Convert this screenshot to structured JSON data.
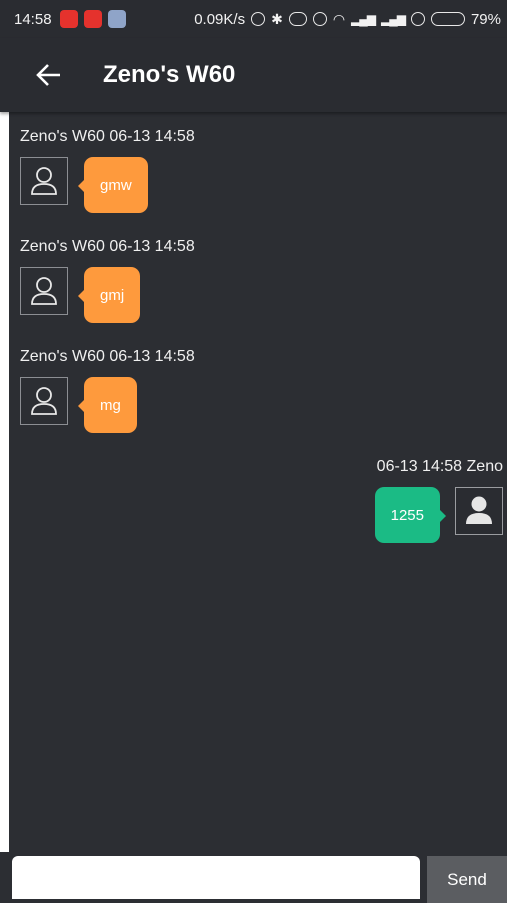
{
  "status_bar": {
    "time": "14:58",
    "net_speed": "0.09K/s",
    "battery_percent": "79%",
    "battery_level": 0.79
  },
  "header": {
    "title": "Zeno's W60"
  },
  "messages": [
    {
      "direction": "incoming",
      "meta": "Zeno's W60  06-13 14:58",
      "text": "gmw"
    },
    {
      "direction": "incoming",
      "meta": "Zeno's W60  06-13 14:58",
      "text": "gmj"
    },
    {
      "direction": "incoming",
      "meta": "Zeno's W60  06-13 14:58",
      "text": "mg"
    },
    {
      "direction": "outgoing",
      "meta": "06-13 14:58  Zeno",
      "text": "1255"
    }
  ],
  "composer": {
    "input_value": "",
    "send_label": "Send"
  },
  "colors": {
    "incoming_bubble": "#fe9a3d",
    "outgoing_bubble": "#1bbb85",
    "background": "#2c2e33"
  }
}
